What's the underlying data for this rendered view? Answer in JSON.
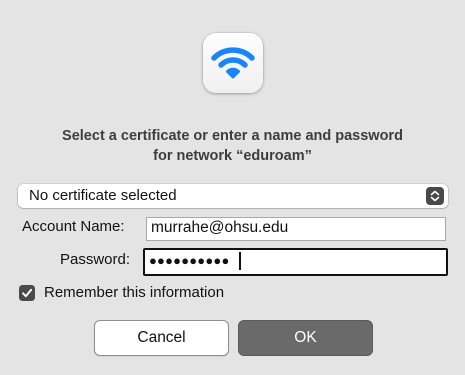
{
  "dialog": {
    "icon": "wifi-icon",
    "accent_color": "#1a86f5",
    "prompt_line1": "Select a certificate or enter a name and password",
    "prompt_line2": "for network “eduroam”"
  },
  "certificate": {
    "selected": "No certificate selected",
    "icon": "chevron-updown-icon"
  },
  "account": {
    "label": "Account Name:",
    "value": "murrahe@ohsu.edu"
  },
  "password": {
    "label": "Password:",
    "masked_value": "●●●●●●●●●●"
  },
  "remember": {
    "label": "Remember this information",
    "checked": true,
    "icon": "checkmark-icon"
  },
  "buttons": {
    "cancel": "Cancel",
    "ok": "OK"
  }
}
